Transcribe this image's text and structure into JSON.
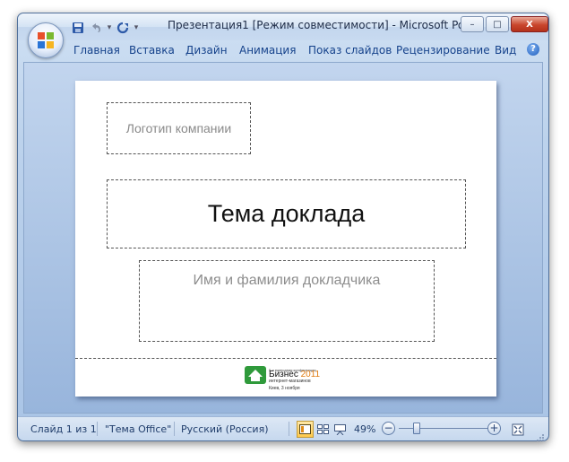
{
  "window": {
    "title": "Презентация1 [Режим совместимости] - Microsoft Po...",
    "controls": {
      "minimize": "–",
      "maximize": "□",
      "close": "X"
    }
  },
  "quick_access": {
    "icons": [
      "save-icon",
      "undo-icon",
      "redo-icon",
      "customize-icon"
    ]
  },
  "ribbon": {
    "tabs": [
      "Главная",
      "Вставка",
      "Дизайн",
      "Анимация",
      "Показ слайдов",
      "Рецензирование",
      "Вид"
    ],
    "help": "?"
  },
  "slide": {
    "logo_placeholder": "Логотип компании",
    "title": "Тема доклада",
    "author_placeholder": "Имя и фамилия докладчика",
    "conference": {
      "small_line": "5-я ежегодная конференция",
      "name": "Бизнес",
      "year": "2011",
      "subtitle": "интернет-магазинов",
      "place_date": "Киев, 3 ноября",
      "brand_color": "#2f9a3b",
      "accent_color": "#e07b10"
    }
  },
  "statusbar": {
    "slide_info": "Слайд 1 из 1",
    "theme": "\"Тема Office\"",
    "language": "Русский (Россия)",
    "zoom": "49%",
    "zoom_out": "−",
    "zoom_in": "+",
    "active_view": "normal"
  }
}
